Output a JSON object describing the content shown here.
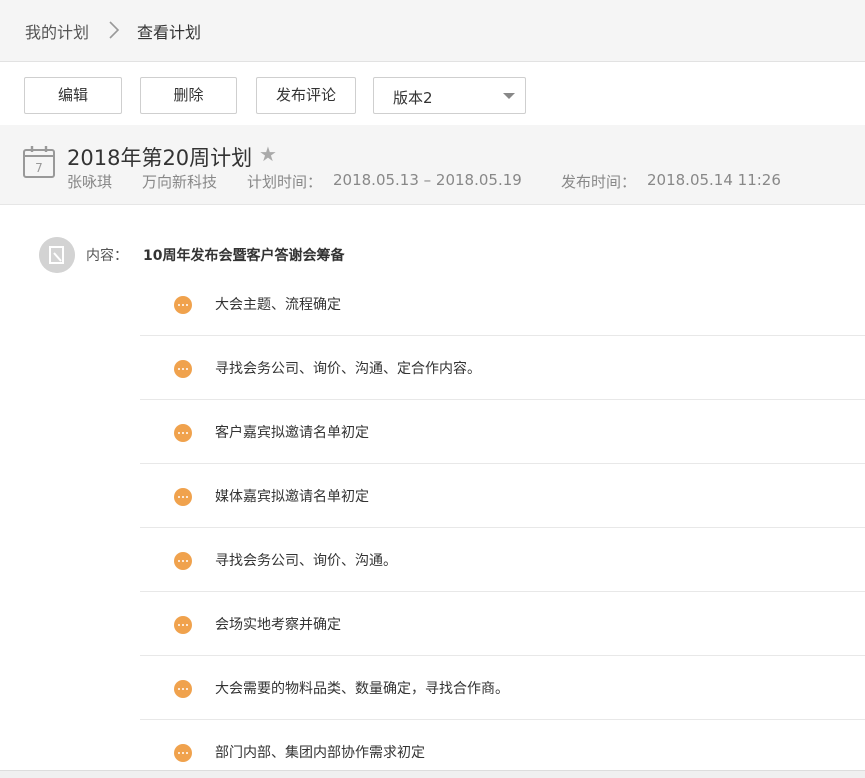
{
  "breadcrumb": {
    "first": "我的计划",
    "current": "查看计划"
  },
  "toolbar": {
    "edit_label": "编辑",
    "delete_label": "删除",
    "comment_label": "发布评论",
    "version_value": "版本2"
  },
  "plan": {
    "calendar_day": "7",
    "title": "2018年第20周计划",
    "author": "张咏琪",
    "company": "万向新科技",
    "plan_time_label": "计划时间：",
    "plan_time_range": "2018.05.13 – 2018.05.19",
    "publish_time_label": "发布时间：",
    "publish_time": "2018.05.14 11:26"
  },
  "content": {
    "label": "内容：",
    "title": "10周年发布会暨客户答谢会筹备",
    "items": [
      "大会主题、流程确定",
      "寻找会务公司、询价、沟通、定合作内容。",
      "客户嘉宾拟邀请名单初定",
      "媒体嘉宾拟邀请名单初定",
      "寻找会务公司、询价、沟通。",
      "会场实地考察并确定",
      "大会需要的物料品类、数量确定，寻找合作商。",
      "部门内部、集团内部协作需求初定"
    ]
  },
  "colors": {
    "accent": "#f0a24d",
    "header_bg": "#f5f5f5",
    "meta_text": "#888888"
  }
}
